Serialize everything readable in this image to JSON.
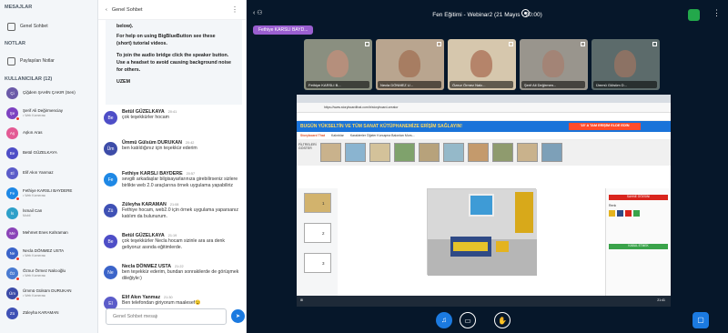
{
  "left": {
    "messages_title": "MESAJLAR",
    "public_chat": "Genel Sohbet",
    "notes_title": "NOTLAR",
    "shared_notes": "Paylaşılan Notlar",
    "users_title": "KULLANICILAR (12)",
    "users": [
      {
        "initials": "Çi",
        "name": "Çiğdem ŞAHİN ÇAKIR (Sen)",
        "sub": "",
        "color": "#6b5aa8"
      },
      {
        "initials": "Şe",
        "name": "Şerif Ali Değirmenciay",
        "sub": "• Web Kamerası",
        "color": "#7d42c1"
      },
      {
        "initials": "Aş",
        "name": "Aşkın Aras",
        "sub": "",
        "color": "#e35a94"
      },
      {
        "initials": "Be",
        "name": "Betül GÜZELKAYA",
        "sub": "",
        "color": "#4e4ec7"
      },
      {
        "initials": "El",
        "name": "Elif Akın Yanmaz",
        "sub": "",
        "color": "#5b5cc9"
      },
      {
        "initials": "Fe",
        "name": "Fethiye KARSLI BAYDERE",
        "sub": "• Web Kamerası",
        "color": "#1e88e5"
      },
      {
        "initials": "İs",
        "name": "İsmail Can",
        "sub": "Mobil",
        "color": "#2ea0c9"
      },
      {
        "initials": "Me",
        "name": "Mehmet Enes Kahraman",
        "sub": "",
        "color": "#8b44b8"
      },
      {
        "initials": "Ne",
        "name": "Necla DÖNMEZ USTA",
        "sub": "• Web Kamerası",
        "color": "#3b64c9"
      },
      {
        "initials": "Öz",
        "name": "Öznur Örmez Nalcıoğlu",
        "sub": "• Web Kamerası",
        "color": "#4a7bd1"
      },
      {
        "initials": "Üm",
        "name": "Ümmü Gülsüm DURUKAN",
        "sub": "• Web Kamerası",
        "color": "#3d4ca8"
      },
      {
        "initials": "Zü",
        "name": "Züleyha KARAMAN",
        "sub": "",
        "color": "#3f51b5"
      }
    ]
  },
  "chat": {
    "title": "Genel Sohbet",
    "welcome": [
      "For help on using BigBlueButton see these (short) tutorial videos.",
      "To join the audio bridge click the speaker button. Use a headset to avoid causing background noise for others.",
      "UZEM"
    ],
    "welcome_top": "below).",
    "messages": [
      {
        "initials": "Be",
        "color": "#4e4ec7",
        "name": "Betül GÜZELKAYA",
        "time": "20:41",
        "text": "çok teşekkürler hocam"
      },
      {
        "initials": "Üm",
        "color": "#3d4ca8",
        "name": "Ümmü Gülsüm DURUKAN",
        "time": "20:42",
        "text": "ben katıldığınız için teşekkür ederim"
      },
      {
        "initials": "Fe",
        "color": "#1e88e5",
        "name": "Fethiye KARSLI BAYDERE",
        "time": "20:57",
        "text": "sevgili arkadaşlar bilgisayarlarınıza girebilirseniz sizlere birlikte web 2.0 araçlarına örnek uygulama yapabiliriz"
      },
      {
        "initials": "Zü",
        "color": "#3f51b5",
        "name": "Züleyha KARAMAN",
        "time": "21:08",
        "text": "Fethiye hocam, web2.0 için örnek uygulama yaparsanız katılım da bulunurum."
      },
      {
        "initials": "Be",
        "color": "#4e4ec7",
        "name": "Betül GÜZELKAYA",
        "time": "21:19",
        "text": "çok teşekkürler Necla hocam sizinle ara ara denk geliyoruz asında eğitimlerde."
      },
      {
        "initials": "Ne",
        "color": "#3b64c9",
        "name": "Necla DÖNMEZ USTA",
        "time": "21:22",
        "text": "ben teşekkür ederim, bundan sonrakilerde de görüşmek dileğiyle:)"
      },
      {
        "initials": "El",
        "color": "#5b5cc9",
        "name": "Elif Akın Yanmaz",
        "time": "21:30",
        "text": "Ben telefondan giriyorum maalesef😉"
      }
    ],
    "input_placeholder": "Genel Sohbet mesajı"
  },
  "main": {
    "title": "Fen Eğitimi - Webinar2 (21 Mayıs - 20:00)",
    "presenter": "Fethiye KARSLI BAYD...",
    "tiles": [
      {
        "label": "Fethiye KARSLI B..."
      },
      {
        "label": "Necla DÖNMEZ U..."
      },
      {
        "label": "Öznur Örmez Nalc..."
      },
      {
        "label": "Şerif Ali Değirmen..."
      },
      {
        "label": "Ümmü Gülsüm D..."
      }
    ],
    "screen": {
      "url": "https://www.storyboardthat.com/tr/storyboard-creator",
      "banner": "BUGÜN YÜKSELTİN VE TÜM SANAT KÜTÜPHANEMİZE ERİŞİM SAĞLAYIN!",
      "badge": "'15' A TAM ERİŞİM ELDE EDİN",
      "toolbar": "Storyboard That",
      "tab_active": "Kalıntılar",
      "tabs_rest": "Karakterler  Öğeler  Konuşma Balonları  Mors...",
      "filter": "FİLTRELERİ GÖSTER",
      "slides": [
        "1",
        "2",
        "3"
      ],
      "props_colors": "Renk",
      "red_btn": "SAHNE ÖĞESİNİ",
      "green_btn": "KABUL ETMEK",
      "taskbar_time": "21:41"
    }
  }
}
